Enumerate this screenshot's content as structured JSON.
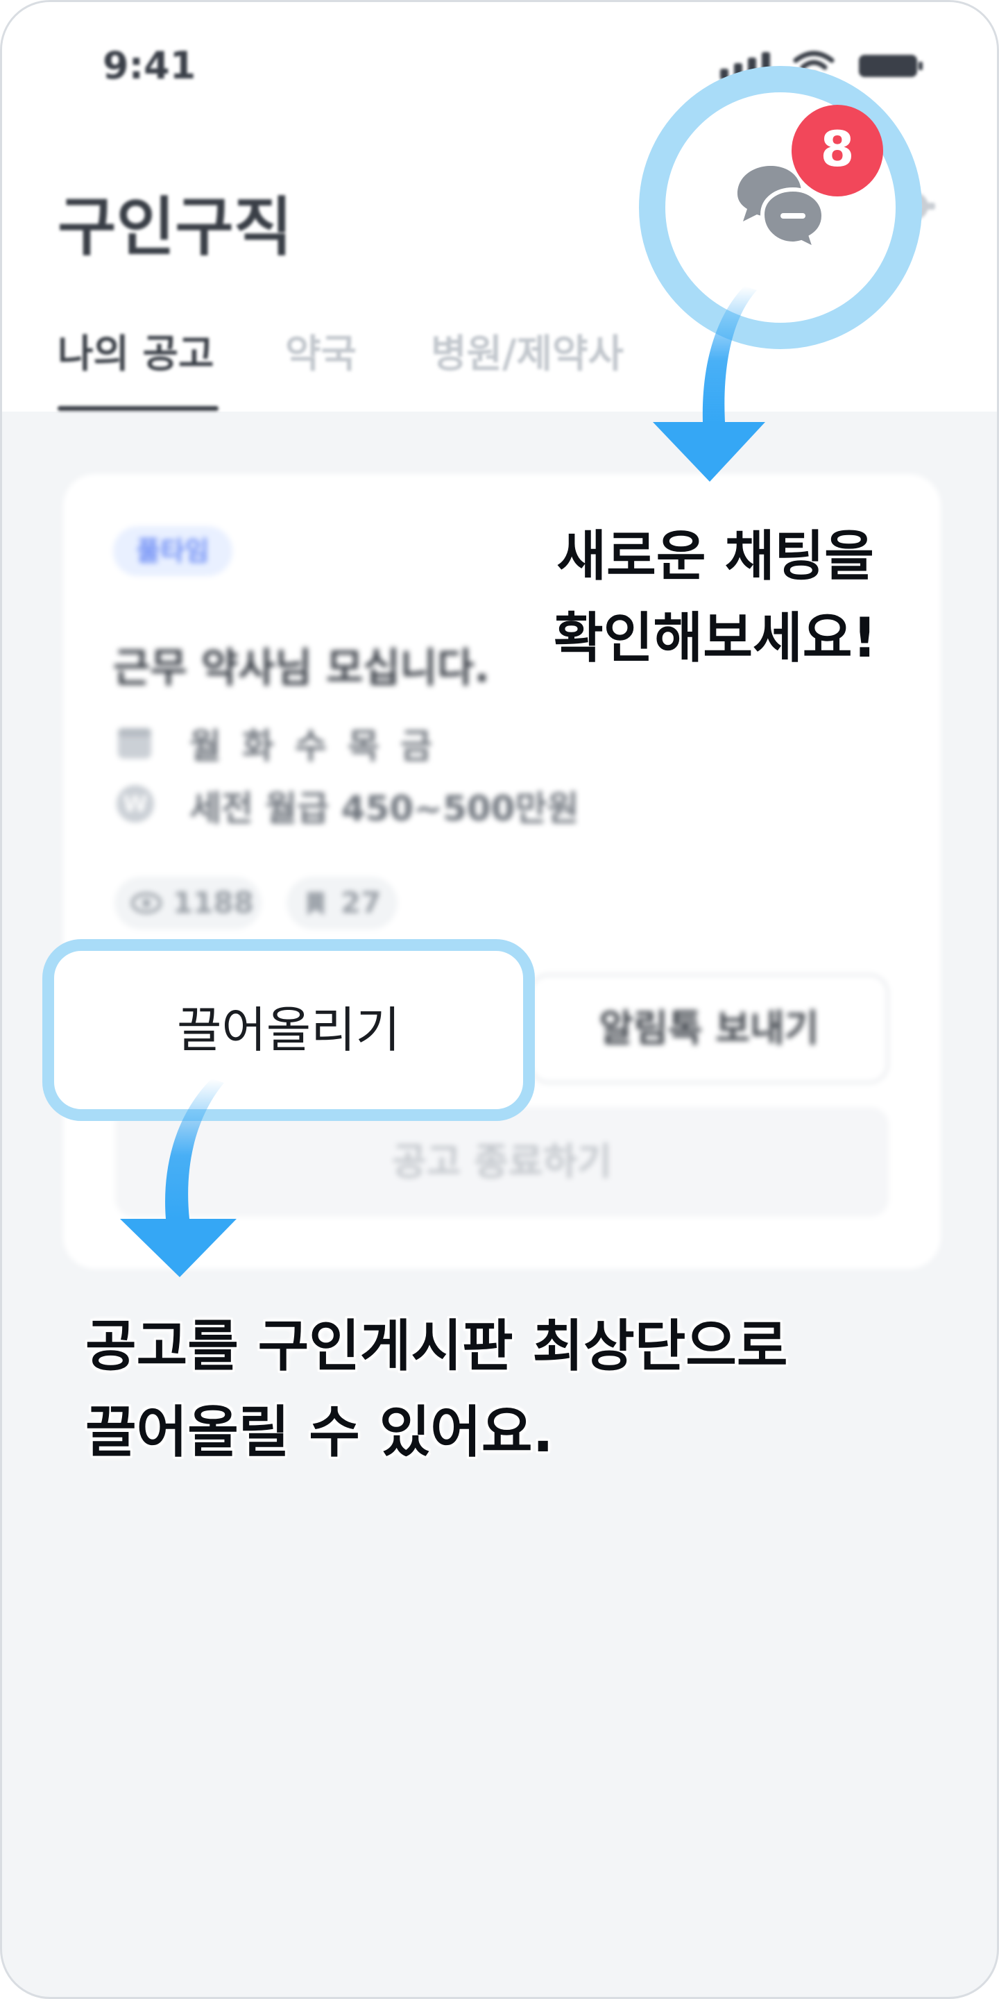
{
  "status_bar": {
    "time": "9:41"
  },
  "header": {
    "title": "구인구직"
  },
  "tabs": [
    {
      "label": "나의 공고"
    },
    {
      "label": "약국"
    },
    {
      "label": "병원/제약사"
    }
  ],
  "notification": {
    "count": "8"
  },
  "job_card": {
    "badge": "풀타임",
    "title": "근무 약사님 모십니다.",
    "days": "월화수목금",
    "salary_icon": "W",
    "salary": "세전 월급 450~500만원",
    "views": "1188",
    "bookmarks": "27",
    "pull_up_label": "끌어올리기",
    "send_alimtalk_label": "알림톡 보내기",
    "close_label": "공고 종료하기"
  },
  "callouts": {
    "chat_line1": "새로운 채팅을",
    "chat_line2": "확인해보세요!",
    "pull_line1": "공고를 구인게시판 최상단으로",
    "pull_line2": "끌어올릴 수 있어요."
  },
  "colors": {
    "highlight_ring": "#a9dcf8",
    "arrow_blue": "#35a7f5",
    "badge_red": "#f2475a",
    "badge_blue_bg": "#e9f0ff"
  },
  "icons": [
    "signal-icon",
    "wifi-icon",
    "battery-icon",
    "chat-icon",
    "gear-icon",
    "calendar-icon",
    "won-icon",
    "eye-icon",
    "bookmark-icon",
    "arrow-down-icon"
  ]
}
